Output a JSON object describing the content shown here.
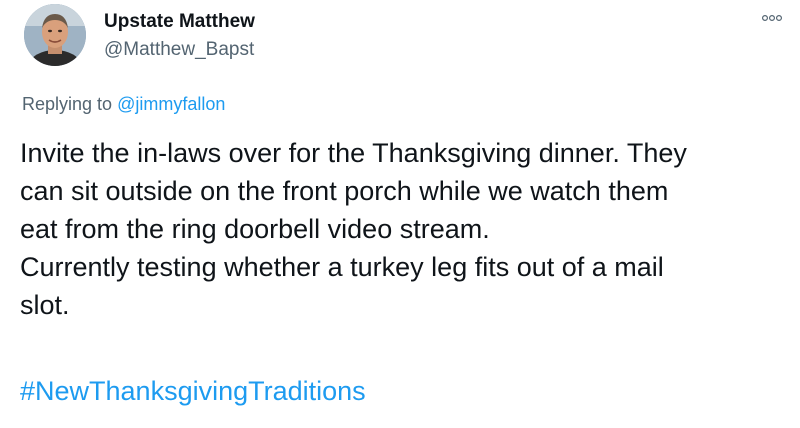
{
  "author": {
    "display_name": "Upstate Matthew",
    "handle": "@Matthew_Bapst",
    "avatar_icon": "profile-photo"
  },
  "menu": {
    "icon": "more-options-icon"
  },
  "reply": {
    "prefix": "Replying to ",
    "mention": "@jimmyfallon"
  },
  "tweet": {
    "lines": [
      "Invite the in-laws over for the Thanksgiving dinner. They",
      "can sit outside on the front porch while we watch them",
      "eat from the ring doorbell video stream.",
      "Currently testing whether a turkey leg fits out of a mail",
      "slot."
    ],
    "hashtag": "#NewThanksgivingTraditions"
  },
  "colors": {
    "link": "#1d9bf0",
    "secondary_text": "#536471",
    "primary_text": "#0f1419"
  }
}
